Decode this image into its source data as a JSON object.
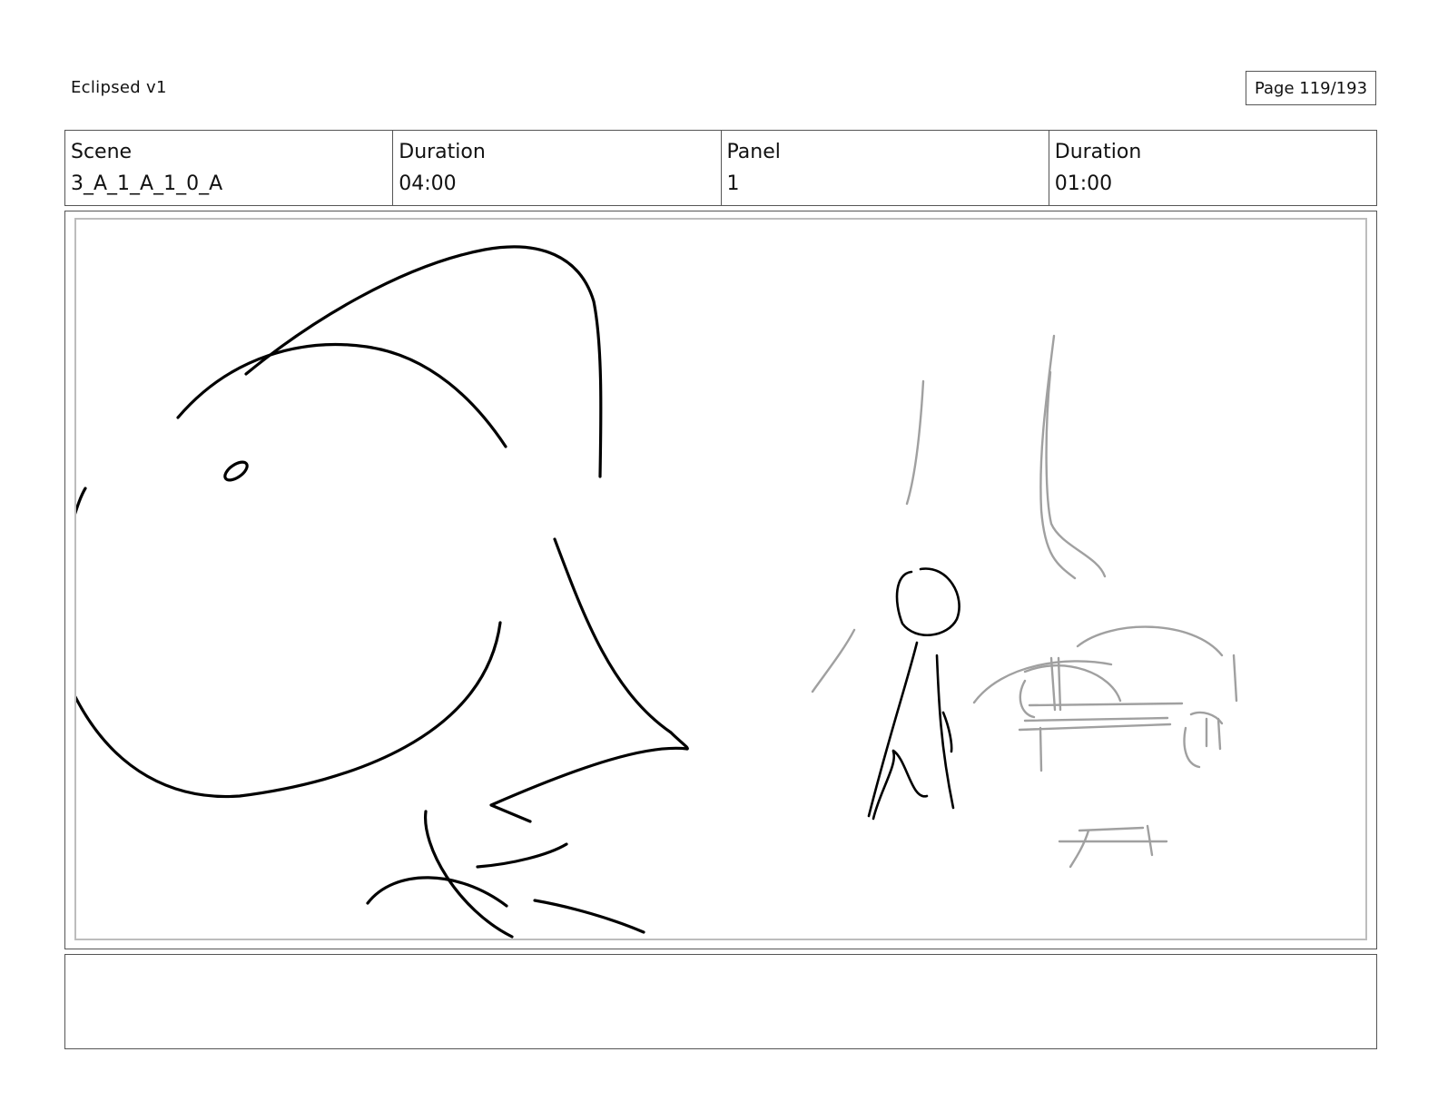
{
  "header": {
    "project_title": "Eclipsed v1",
    "page_label": "Page 119/193"
  },
  "info": {
    "scene_label": "Scene",
    "scene_value": "3_A_1_A_1_0_A",
    "scene_duration_label": "Duration",
    "scene_duration_value": "04:00",
    "panel_label": "Panel",
    "panel_value": "1",
    "panel_duration_label": "Duration",
    "panel_duration_value": "01:00"
  },
  "notes": {
    "text": ""
  },
  "sketch": {
    "ink_color": "#000000",
    "pencil_color": "#a0a0a0"
  }
}
